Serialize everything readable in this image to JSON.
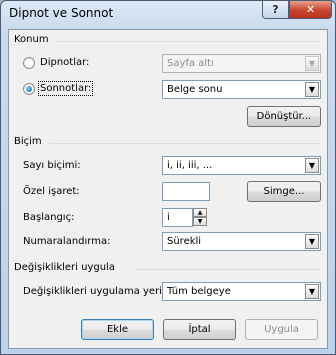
{
  "window": {
    "title": "Dipnot ve Sonnot",
    "help_label": "?",
    "close_label": "✕"
  },
  "konum": {
    "group_label": "Konum",
    "footnotes": {
      "label": "Dipnotlar:",
      "value": "Sayfa altı",
      "selected": false,
      "enabled": false
    },
    "endnotes": {
      "label": "Sonnotlar:",
      "value": "Belge sonu",
      "selected": true,
      "enabled": true
    },
    "convert_label": "Dönüştür..."
  },
  "bicim": {
    "group_label": "Biçim",
    "number_format": {
      "label": "Sayı biçimi:",
      "value": "i, ii, iii, ..."
    },
    "custom_mark": {
      "label": "Özel işaret:",
      "value": "",
      "symbol_label": "Simge..."
    },
    "start_at": {
      "label": "Başlangıç:",
      "value": "i"
    },
    "numbering": {
      "label": "Numaralandırma:",
      "value": "Sürekli"
    }
  },
  "apply": {
    "group_label": "Değişiklikleri uygula",
    "apply_to": {
      "label": "Değişiklikleri uygulama yeri:",
      "value": "Tüm belgeye"
    }
  },
  "buttons": {
    "insert": "Ekle",
    "cancel": "İptal",
    "apply": "Uygula"
  },
  "icons": {
    "dropdown": "chevron-down-icon",
    "spin_up": "spin-up-icon",
    "spin_down": "spin-down-icon"
  }
}
